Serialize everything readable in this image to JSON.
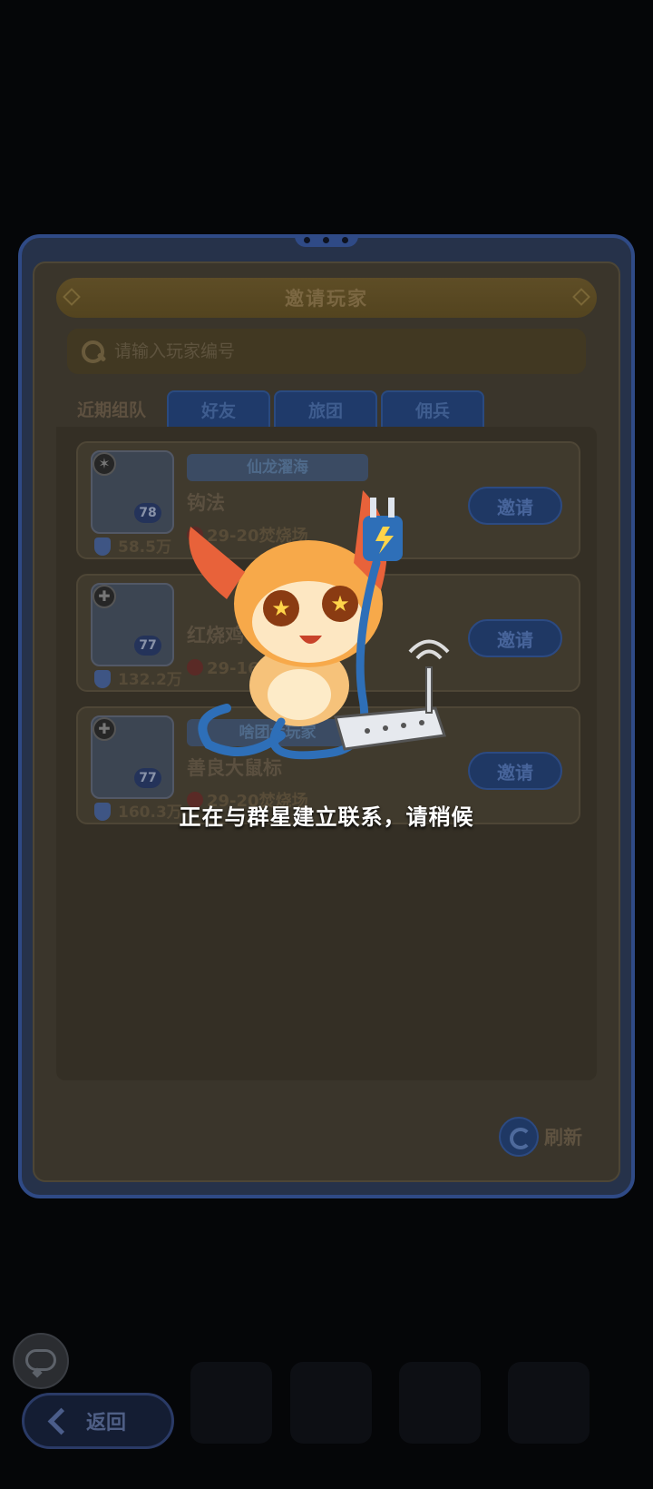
{
  "background": {
    "title": ""
  },
  "dialog": {
    "title": "邀请玩家",
    "search": {
      "placeholder": "请输入玩家编号",
      "value": ""
    },
    "tabs": [
      {
        "label": "近期组队",
        "active": true
      },
      {
        "label": "好友",
        "active": false
      },
      {
        "label": "旅团",
        "active": false
      },
      {
        "label": "佣兵",
        "active": false
      }
    ],
    "players": [
      {
        "name": "钩法",
        "guild": "仙龙濯海",
        "level": "78",
        "power": "58.5万",
        "location": "29-20焚烧场",
        "invite_label": "邀请"
      },
      {
        "name": "红烧鸡",
        "guild": "",
        "level": "77",
        "power": "132.2万",
        "location": "29-16废弃厂",
        "invite_label": "邀请"
      },
      {
        "name": "善良大鼠标",
        "guild": "啥团大玩家",
        "level": "77",
        "power": "160.3万",
        "location": "29-20焚烧场",
        "invite_label": "邀请"
      }
    ],
    "refresh_label": "刷新"
  },
  "footer": {
    "back_label": "返回"
  },
  "loading": {
    "message": "正在与群星建立联系，请稍候"
  },
  "colors": {
    "accent_blue": "#1f3864",
    "panel_border": "#2f4a86",
    "text_white": "#ffffff"
  },
  "icons": [
    "search-icon",
    "shield-icon",
    "location-icon",
    "refresh-icon",
    "chat-icon",
    "back-icon",
    "plug-icon",
    "router-icon"
  ]
}
